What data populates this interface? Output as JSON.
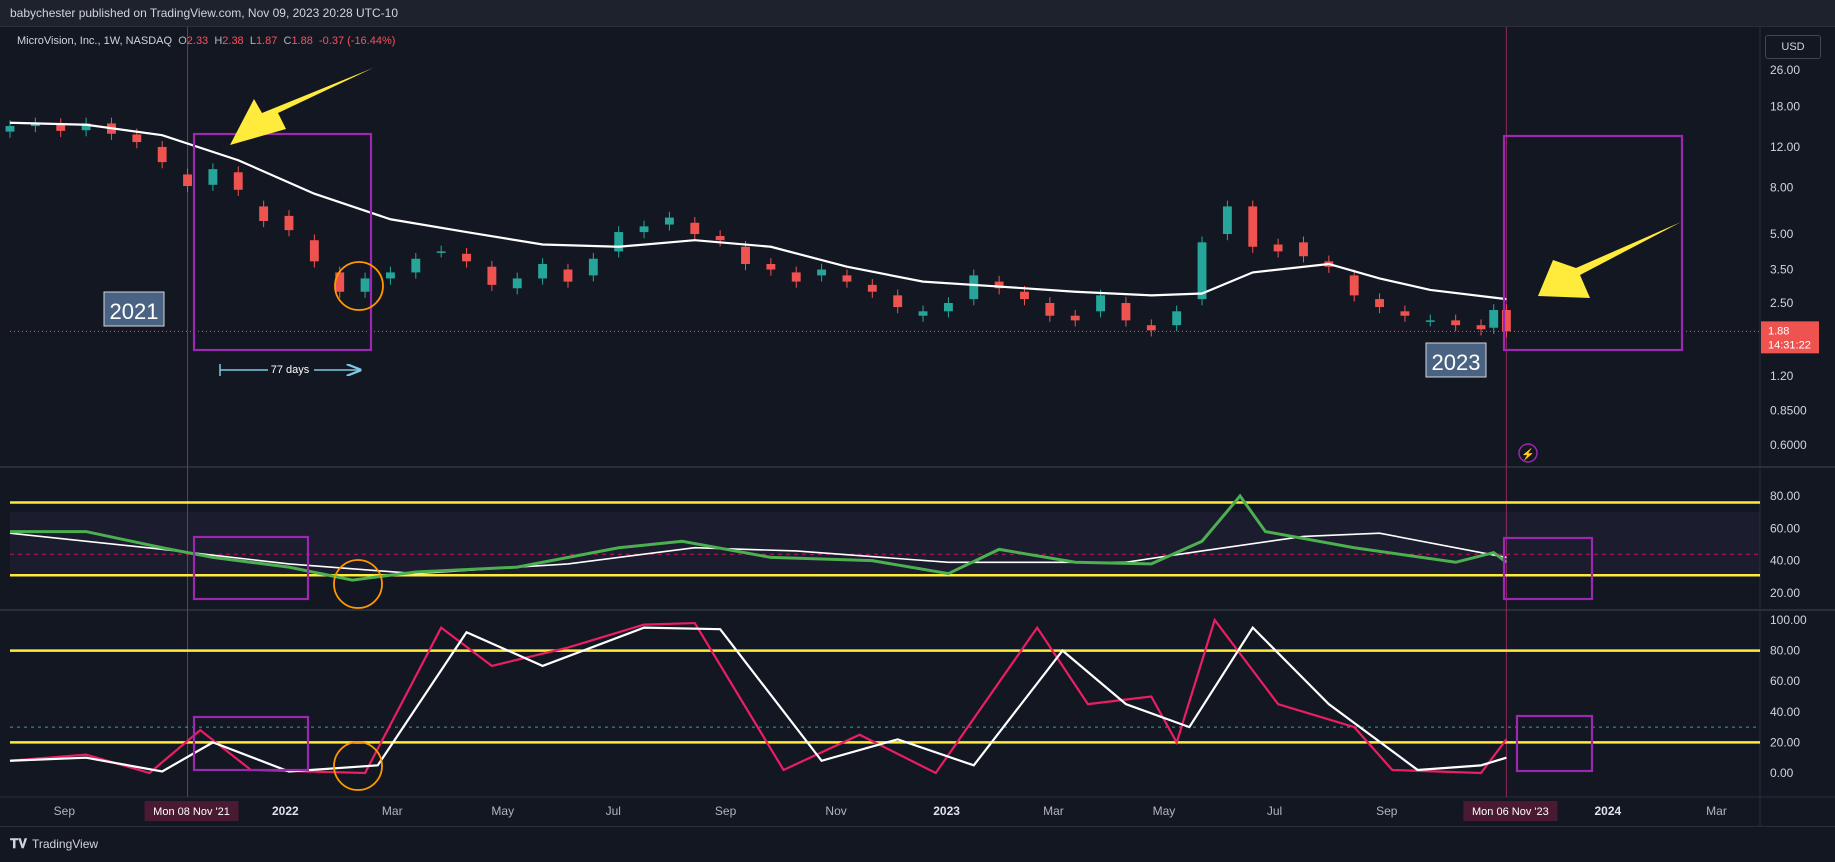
{
  "header": {
    "publisher_line": "babychester published on TradingView.com, Nov 09, 2023 20:28 UTC-10"
  },
  "legend": {
    "symbol": "MicroVision, Inc., 1W, NASDAQ",
    "o_label": "O",
    "o": "2.33",
    "h_label": "H",
    "h": "2.38",
    "l_label": "L",
    "l": "1.87",
    "c_label": "C",
    "c": "1.88",
    "change": "-0.37 (-16.44%)"
  },
  "currency": "USD",
  "price_axis_ticks": [
    "26.00",
    "18.00",
    "12.00",
    "8.00",
    "5.00",
    "3.50",
    "2.50",
    "1.20",
    "0.8500",
    "0.6000"
  ],
  "last_price": {
    "price": "1.88",
    "countdown": "14:31:22"
  },
  "rsi_axis_ticks": [
    "80.00",
    "60.00",
    "40.00",
    "20.00"
  ],
  "stoch_axis_ticks": [
    "100.00",
    "80.00",
    "60.00",
    "40.00",
    "20.00",
    "0.00"
  ],
  "time_axis": {
    "labels": [
      "Sep",
      "2022",
      "Mar",
      "May",
      "Jul",
      "Sep",
      "Nov",
      "2023",
      "Mar",
      "May",
      "Jul",
      "Sep",
      "2024",
      "Mar"
    ],
    "cursor_left": "Mon 08 Nov '21",
    "cursor_right": "Mon 06 Nov '23"
  },
  "annotations": {
    "year_left": "2021",
    "year_right": "2023",
    "days": "77 days"
  },
  "footer": {
    "brand": "TradingView"
  },
  "colors": {
    "up": "#26a69a",
    "down": "#ef5350",
    "ma": "#ffffff",
    "rsi": "#4caf50",
    "stoch_k": "#e91e63",
    "stoch_d": "#ffffff",
    "band": "#ffeb3b",
    "box": "#9c27b0",
    "arrow": "#ffeb3b",
    "circle": "#ff9800",
    "measure": "#7ec8e3"
  },
  "chart_data": [
    {
      "type": "candlestick",
      "title": "MicroVision, Inc., 1W, NASDAQ",
      "scale": "log",
      "ylim": [
        0.55,
        30
      ],
      "x_range": [
        "2021-08-02",
        "2024-03-25"
      ],
      "candles": [
        {
          "d": "2021-08-02",
          "o": 14.0,
          "c": 14.8
        },
        {
          "d": "2021-08-16",
          "o": 14.8,
          "c": 15.2
        },
        {
          "d": "2021-08-30",
          "o": 15.1,
          "c": 14.1
        },
        {
          "d": "2021-09-13",
          "o": 14.2,
          "c": 15.2
        },
        {
          "d": "2021-09-27",
          "o": 15.2,
          "c": 13.7
        },
        {
          "d": "2021-10-11",
          "o": 13.6,
          "c": 12.6
        },
        {
          "d": "2021-10-25",
          "o": 12.0,
          "c": 10.3
        },
        {
          "d": "2021-11-08",
          "o": 9.1,
          "c": 8.1
        },
        {
          "d": "2021-11-22",
          "o": 8.2,
          "c": 9.6
        },
        {
          "d": "2021-12-06",
          "o": 9.3,
          "c": 7.8
        },
        {
          "d": "2021-12-20",
          "o": 6.6,
          "c": 5.7
        },
        {
          "d": "2022-01-03",
          "o": 6.0,
          "c": 5.2
        },
        {
          "d": "2022-01-17",
          "o": 4.7,
          "c": 3.8
        },
        {
          "d": "2022-01-31",
          "o": 3.4,
          "c": 2.8
        },
        {
          "d": "2022-02-14",
          "o": 2.8,
          "c": 3.2
        },
        {
          "d": "2022-02-28",
          "o": 3.2,
          "c": 3.4
        },
        {
          "d": "2022-03-14",
          "o": 3.4,
          "c": 3.9
        },
        {
          "d": "2022-03-28",
          "o": 4.2,
          "c": 4.2
        },
        {
          "d": "2022-04-11",
          "o": 4.1,
          "c": 3.8
        },
        {
          "d": "2022-04-25",
          "o": 3.6,
          "c": 3.0
        },
        {
          "d": "2022-05-09",
          "o": 2.9,
          "c": 3.2
        },
        {
          "d": "2022-05-23",
          "o": 3.2,
          "c": 3.7
        },
        {
          "d": "2022-06-06",
          "o": 3.5,
          "c": 3.1
        },
        {
          "d": "2022-06-20",
          "o": 3.3,
          "c": 3.9
        },
        {
          "d": "2022-07-04",
          "o": 4.2,
          "c": 5.1
        },
        {
          "d": "2022-07-18",
          "o": 5.1,
          "c": 5.4
        },
        {
          "d": "2022-08-01",
          "o": 5.5,
          "c": 5.9
        },
        {
          "d": "2022-08-15",
          "o": 5.6,
          "c": 5.0
        },
        {
          "d": "2022-08-29",
          "o": 4.9,
          "c": 4.7
        },
        {
          "d": "2022-09-12",
          "o": 4.4,
          "c": 3.7
        },
        {
          "d": "2022-09-26",
          "o": 3.7,
          "c": 3.5
        },
        {
          "d": "2022-10-10",
          "o": 3.4,
          "c": 3.1
        },
        {
          "d": "2022-10-24",
          "o": 3.3,
          "c": 3.5
        },
        {
          "d": "2022-11-07",
          "o": 3.3,
          "c": 3.1
        },
        {
          "d": "2022-11-21",
          "o": 3.0,
          "c": 2.8
        },
        {
          "d": "2022-12-05",
          "o": 2.7,
          "c": 2.4
        },
        {
          "d": "2022-12-19",
          "o": 2.2,
          "c": 2.3
        },
        {
          "d": "2023-01-02",
          "o": 2.3,
          "c": 2.5
        },
        {
          "d": "2023-01-16",
          "o": 2.6,
          "c": 3.3
        },
        {
          "d": "2023-01-30",
          "o": 3.1,
          "c": 2.9
        },
        {
          "d": "2023-02-13",
          "o": 2.8,
          "c": 2.6
        },
        {
          "d": "2023-02-27",
          "o": 2.5,
          "c": 2.2
        },
        {
          "d": "2023-03-13",
          "o": 2.2,
          "c": 2.1
        },
        {
          "d": "2023-03-27",
          "o": 2.3,
          "c": 2.7
        },
        {
          "d": "2023-04-10",
          "o": 2.5,
          "c": 2.1
        },
        {
          "d": "2023-04-24",
          "o": 2.0,
          "c": 1.9
        },
        {
          "d": "2023-05-08",
          "o": 2.0,
          "c": 2.3
        },
        {
          "d": "2023-05-22",
          "o": 2.6,
          "c": 4.6
        },
        {
          "d": "2023-06-05",
          "o": 5.0,
          "c": 6.6
        },
        {
          "d": "2023-06-19",
          "o": 6.6,
          "c": 4.4
        },
        {
          "d": "2023-07-03",
          "o": 4.5,
          "c": 4.2
        },
        {
          "d": "2023-07-17",
          "o": 4.6,
          "c": 4.0
        },
        {
          "d": "2023-07-31",
          "o": 3.8,
          "c": 3.6
        },
        {
          "d": "2023-08-14",
          "o": 3.3,
          "c": 2.7
        },
        {
          "d": "2023-08-28",
          "o": 2.6,
          "c": 2.4
        },
        {
          "d": "2023-09-11",
          "o": 2.3,
          "c": 2.2
        },
        {
          "d": "2023-09-25",
          "o": 2.1,
          "c": 2.1
        },
        {
          "d": "2023-10-09",
          "o": 2.1,
          "c": 2.0
        },
        {
          "d": "2023-10-23",
          "o": 2.0,
          "c": 1.92
        },
        {
          "d": "2023-10-30",
          "o": 1.95,
          "c": 2.33
        },
        {
          "d": "2023-11-06",
          "o": 2.33,
          "c": 1.88
        }
      ],
      "moving_average": [
        {
          "d": "2021-08-02",
          "v": 15.3
        },
        {
          "d": "2021-09-13",
          "v": 15.0
        },
        {
          "d": "2021-10-25",
          "v": 13.5
        },
        {
          "d": "2021-12-06",
          "v": 10.5
        },
        {
          "d": "2022-01-17",
          "v": 7.5
        },
        {
          "d": "2022-02-28",
          "v": 5.8
        },
        {
          "d": "2022-04-11",
          "v": 5.1
        },
        {
          "d": "2022-05-23",
          "v": 4.5
        },
        {
          "d": "2022-07-04",
          "v": 4.4
        },
        {
          "d": "2022-08-15",
          "v": 4.7
        },
        {
          "d": "2022-09-26",
          "v": 4.4
        },
        {
          "d": "2022-11-07",
          "v": 3.6
        },
        {
          "d": "2022-12-19",
          "v": 3.1
        },
        {
          "d": "2023-01-30",
          "v": 2.95
        },
        {
          "d": "2023-03-13",
          "v": 2.8
        },
        {
          "d": "2023-04-24",
          "v": 2.7
        },
        {
          "d": "2023-05-22",
          "v": 2.75
        },
        {
          "d": "2023-06-19",
          "v": 3.4
        },
        {
          "d": "2023-07-31",
          "v": 3.7
        },
        {
          "d": "2023-08-28",
          "v": 3.2
        },
        {
          "d": "2023-09-25",
          "v": 2.85
        },
        {
          "d": "2023-11-06",
          "v": 2.6
        }
      ]
    },
    {
      "type": "line",
      "ylim": [
        10,
        95
      ],
      "levels": [
        30,
        70
      ],
      "midline": 50,
      "series": [
        {
          "values": [
            {
              "d": "2021-08-02",
              "v": 58
            },
            {
              "d": "2021-09-13",
              "v": 58
            },
            {
              "d": "2021-10-25",
              "v": 48
            },
            {
              "d": "2021-11-22",
              "v": 42
            },
            {
              "d": "2022-01-03",
              "v": 36
            },
            {
              "d": "2022-02-07",
              "v": 28
            },
            {
              "d": "2022-03-14",
              "v": 33
            },
            {
              "d": "2022-05-09",
              "v": 36
            },
            {
              "d": "2022-07-04",
              "v": 48
            },
            {
              "d": "2022-08-08",
              "v": 52
            },
            {
              "d": "2022-09-26",
              "v": 42
            },
            {
              "d": "2022-11-21",
              "v": 40
            },
            {
              "d": "2023-01-02",
              "v": 32
            },
            {
              "d": "2023-01-30",
              "v": 47
            },
            {
              "d": "2023-03-13",
              "v": 39
            },
            {
              "d": "2023-04-24",
              "v": 38
            },
            {
              "d": "2023-05-22",
              "v": 52
            },
            {
              "d": "2023-06-12",
              "v": 80
            },
            {
              "d": "2023-06-26",
              "v": 58
            },
            {
              "d": "2023-08-14",
              "v": 48
            },
            {
              "d": "2023-10-09",
              "v": 39
            },
            {
              "d": "2023-10-30",
              "v": 45
            },
            {
              "d": "2023-11-06",
              "v": 39
            }
          ]
        },
        {
          "values": [
            {
              "d": "2021-08-02",
              "v": 57
            },
            {
              "d": "2021-10-25",
              "v": 47
            },
            {
              "d": "2022-01-03",
              "v": 38
            },
            {
              "d": "2022-03-14",
              "v": 32
            },
            {
              "d": "2022-06-06",
              "v": 38
            },
            {
              "d": "2022-08-15",
              "v": 48
            },
            {
              "d": "2022-10-10",
              "v": 46
            },
            {
              "d": "2023-01-02",
              "v": 39
            },
            {
              "d": "2023-04-10",
              "v": 39
            },
            {
              "d": "2023-05-22",
              "v": 46
            },
            {
              "d": "2023-07-17",
              "v": 55
            },
            {
              "d": "2023-08-28",
              "v": 57
            },
            {
              "d": "2023-11-06",
              "v": 42
            }
          ]
        }
      ]
    },
    {
      "type": "line",
      "ylim": [
        -25,
        110
      ],
      "levels": [
        20,
        80
      ],
      "midline": 30,
      "series": [
        {
          "values": [
            {
              "d": "2021-08-02",
              "v": 8
            },
            {
              "d": "2021-09-13",
              "v": 12
            },
            {
              "d": "2021-10-18",
              "v": 0
            },
            {
              "d": "2021-11-15",
              "v": 28
            },
            {
              "d": "2021-12-13",
              "v": 2
            },
            {
              "d": "2022-02-14",
              "v": 0
            },
            {
              "d": "2022-03-28",
              "v": 95
            },
            {
              "d": "2022-04-25",
              "v": 70
            },
            {
              "d": "2022-06-06",
              "v": 82
            },
            {
              "d": "2022-07-18",
              "v": 97
            },
            {
              "d": "2022-08-15",
              "v": 98
            },
            {
              "d": "2022-10-03",
              "v": 2
            },
            {
              "d": "2022-11-14",
              "v": 25
            },
            {
              "d": "2022-12-26",
              "v": 0
            },
            {
              "d": "2023-02-20",
              "v": 95
            },
            {
              "d": "2023-03-20",
              "v": 45
            },
            {
              "d": "2023-04-24",
              "v": 50
            },
            {
              "d": "2023-05-08",
              "v": 20
            },
            {
              "d": "2023-05-29",
              "v": 100
            },
            {
              "d": "2023-07-03",
              "v": 45
            },
            {
              "d": "2023-08-14",
              "v": 30
            },
            {
              "d": "2023-09-04",
              "v": 2
            },
            {
              "d": "2023-10-23",
              "v": 0
            },
            {
              "d": "2023-11-06",
              "v": 22
            }
          ]
        },
        {
          "values": [
            {
              "d": "2021-08-02",
              "v": 8
            },
            {
              "d": "2021-09-13",
              "v": 10
            },
            {
              "d": "2021-10-25",
              "v": 1
            },
            {
              "d": "2021-11-22",
              "v": 20
            },
            {
              "d": "2022-01-03",
              "v": 1
            },
            {
              "d": "2022-02-21",
              "v": 5
            },
            {
              "d": "2022-04-11",
              "v": 92
            },
            {
              "d": "2022-05-23",
              "v": 70
            },
            {
              "d": "2022-07-18",
              "v": 95
            },
            {
              "d": "2022-08-29",
              "v": 94
            },
            {
              "d": "2022-10-24",
              "v": 8
            },
            {
              "d": "2022-12-05",
              "v": 22
            },
            {
              "d": "2023-01-16",
              "v": 5
            },
            {
              "d": "2023-03-06",
              "v": 80
            },
            {
              "d": "2023-04-10",
              "v": 45
            },
            {
              "d": "2023-05-15",
              "v": 30
            },
            {
              "d": "2023-06-19",
              "v": 95
            },
            {
              "d": "2023-07-31",
              "v": 45
            },
            {
              "d": "2023-09-18",
              "v": 2
            },
            {
              "d": "2023-10-23",
              "v": 5
            },
            {
              "d": "2023-11-06",
              "v": 10
            }
          ]
        }
      ]
    }
  ]
}
